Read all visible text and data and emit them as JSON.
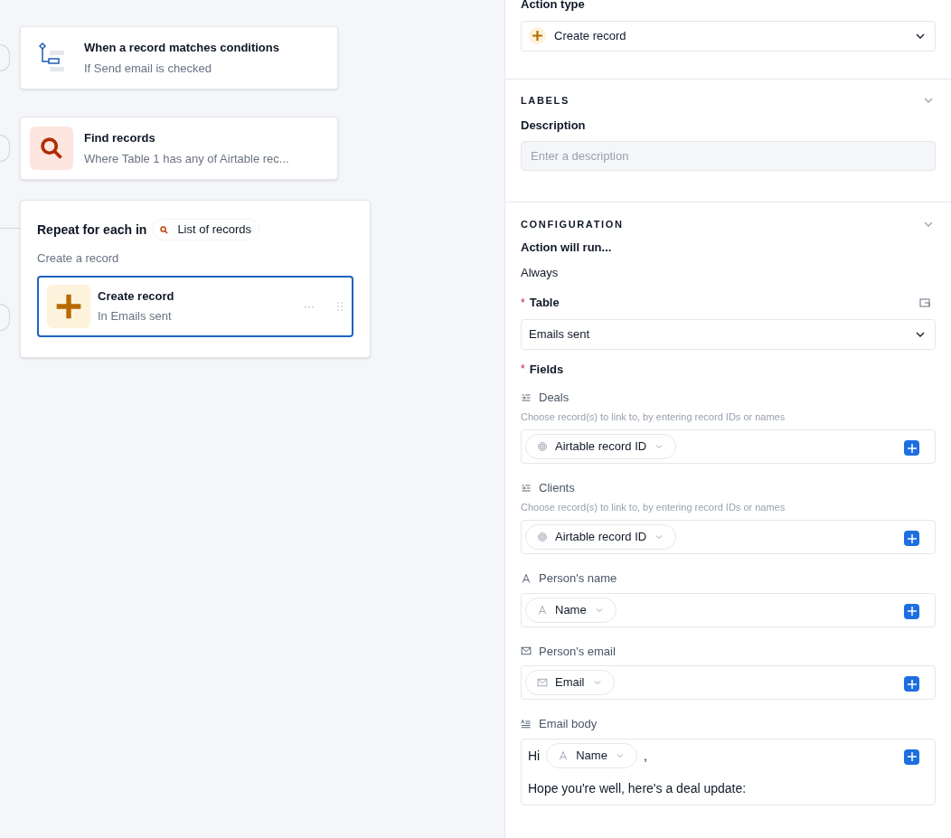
{
  "canvas": {
    "steps": [
      {
        "kind": "trigger",
        "title": "When a record matches conditions",
        "subtitle": "If Send email is checked"
      },
      {
        "kind": "find",
        "title": "Find records",
        "subtitle": "Where Table 1 has any of Airtable rec..."
      }
    ],
    "repeat": {
      "heading": "Repeat for each in",
      "source": "List of records",
      "caption": "Create a record",
      "action": {
        "title": "Create record",
        "subtitle": "In Emails sent",
        "selected": true,
        "menu": "···"
      }
    }
  },
  "panel": {
    "action_type": {
      "label": "Action type",
      "value": "Create record"
    },
    "labels": {
      "title": "LABELS",
      "expanded": true,
      "description_label": "Description",
      "placeholder": "Enter a description"
    },
    "configuration": {
      "title": "CONFIGURATION",
      "expanded": true,
      "run_label": "Action will run...",
      "run_value": "Always",
      "required_mark": "*",
      "table_label": "Table",
      "table_value": "Emails sent",
      "fields_label": "Fields",
      "fields": [
        {
          "kind": "link",
          "label": "Deals",
          "hint": "Choose record(s) to link to, by entering record IDs or names",
          "lines": [
            [
              {
                "kind": "id_token",
                "label": "Airtable record ID"
              }
            ]
          ]
        },
        {
          "kind": "link",
          "label": "Clients",
          "hint": "Choose record(s) to link to, by entering record IDs or names",
          "lines": [
            [
              {
                "kind": "id_token",
                "label": "Airtable record ID"
              }
            ]
          ]
        },
        {
          "kind": "text",
          "label": "Person's name",
          "lines": [
            [
              {
                "kind": "text_token",
                "label": "Name"
              }
            ]
          ]
        },
        {
          "kind": "email",
          "label": "Person's email",
          "lines": [
            [
              {
                "kind": "email_token",
                "label": "Email"
              }
            ]
          ]
        },
        {
          "kind": "longtext",
          "label": "Email body",
          "lines": [
            [
              {
                "kind": "text",
                "text": "Hi"
              },
              {
                "kind": "text_token",
                "label": "Name"
              },
              {
                "kind": "text",
                "text": ","
              }
            ],
            [
              {
                "kind": "text",
                "text": "Hope you're well, here's a deal update:"
              }
            ]
          ]
        }
      ]
    }
  }
}
